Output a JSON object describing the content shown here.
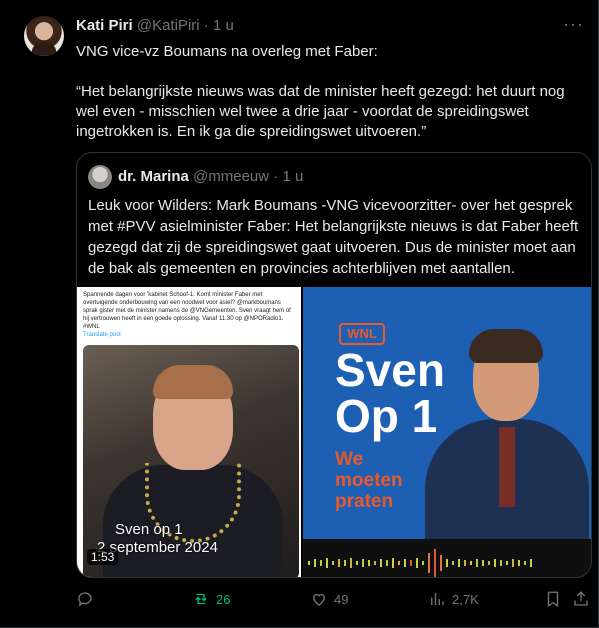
{
  "tweet": {
    "author_name": "Kati Piri",
    "author_handle": "@KatiPiri",
    "separator": "·",
    "time": "1 u",
    "text": "VNG vice-vz Boumans na overleg met Faber:\n\n“Het belangrijkste nieuws was dat de minister heeft gezegd: het duurt nog wel even - misschien wel twee a drie jaar - voordat de spreidingswet ingetrokken is. En ik ga die spreidingswet uitvoeren.”"
  },
  "quoted": {
    "author_name": "dr. Marina",
    "author_handle": "@mmeeuw",
    "separator": "·",
    "time": "1 u",
    "text": "Leuk voor Wilders: Mark Boumans -VNG vicevoorzitter- over het gesprek met #PVV asielminister Faber: Het belangrijkste nieuws is dat Faber heeft gezegd dat zij de spreidingswet gaat uitvoeren. Dus de minister moet aan de bak als gemeenten en provincies achterblijven met aantallen.",
    "media": {
      "left_snippet": "Spannende dagen voor 'kabinet Schoof-1. Komt minister Faber met overtuigende onderbouwing van een noodwet voor asiel? @markboumans sprak gister met de minister namens de @VNGemeenten. Sven vraagt hem of hij vertrouwen heeft in een goede oplossing. Vanaf 11.30 op @NPORadio1. #WNL",
      "left_translate": "Translate post",
      "caption_line1": "Sven op 1",
      "caption_line2": "2 september 2024",
      "timer": "1:53",
      "logo": "WNL",
      "show_title_1": "Sven",
      "show_title_2": "Op 1",
      "tagline": "We moeten praten"
    }
  },
  "actions": {
    "reposts": "26",
    "likes": "49",
    "views": "2,7K"
  },
  "colors": {
    "background": "#000000",
    "text": "#e7e9ea",
    "muted": "#71767b",
    "repost_green": "#00ba7c",
    "show_blue": "#1d5fb3",
    "show_orange": "#e85a2b"
  }
}
